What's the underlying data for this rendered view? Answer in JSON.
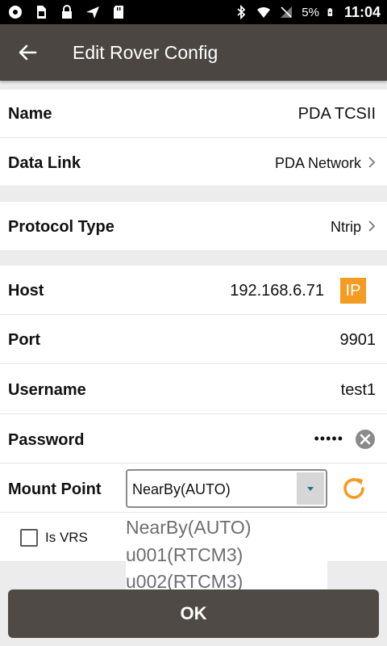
{
  "status_bar": {
    "battery": "5%",
    "time": "11:04"
  },
  "app_bar": {
    "title": "Edit Rover Config"
  },
  "form": {
    "name": {
      "label": "Name",
      "value": "PDA TCSII"
    },
    "data_link": {
      "label": "Data Link",
      "value": "PDA Network"
    },
    "protocol_type": {
      "label": "Protocol Type",
      "value": "Ntrip"
    },
    "host": {
      "label": "Host",
      "value": "192.168.6.71",
      "badge": "IP"
    },
    "port": {
      "label": "Port",
      "value": "9901"
    },
    "username": {
      "label": "Username",
      "value": "test1"
    },
    "password": {
      "label": "Password",
      "value": "•••••"
    },
    "mount_point": {
      "label": "Mount Point",
      "selected": "NearBy(AUTO)",
      "options": [
        "NearBy(AUTO)",
        "u001(RTCM3)",
        "u002(RTCM3)"
      ]
    },
    "is_vrs": {
      "label": "Is VRS",
      "checked": false
    }
  },
  "ok_button": {
    "label": "OK"
  },
  "colors": {
    "app_bar": "#4b4641",
    "accent": "#f49b22",
    "ok_button": "#4f4a45"
  }
}
